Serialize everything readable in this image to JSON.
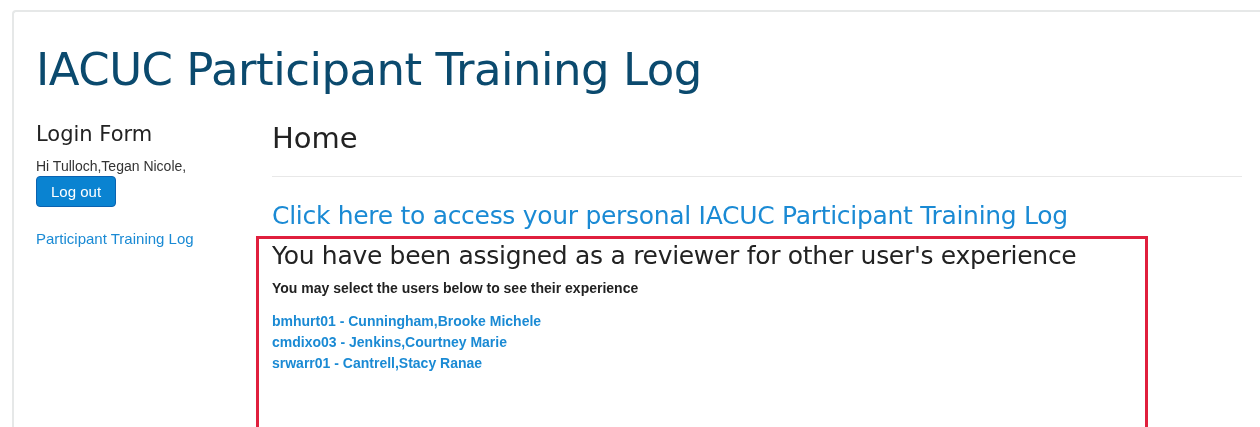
{
  "site_title": "IACUC Participant Training Log",
  "sidebar": {
    "heading": "Login Form",
    "greeting": "Hi Tulloch,Tegan Nicole,",
    "logout_button": "Log out",
    "links": [
      "Participant Training Log"
    ]
  },
  "main": {
    "heading": "Home",
    "access_link": "Click here to access your personal IACUC Participant Training Log",
    "reviewer_panel": {
      "heading": "You have been assigned as a reviewer for other user's experience",
      "instruction": "You may select the users below to see their experience",
      "users": [
        "bmhurt01 - Cunningham,Brooke Michele",
        "cmdixo03 - Jenkins,Courtney Marie",
        "srwarr01 - Cantrell,Stacy Ranae"
      ]
    }
  }
}
